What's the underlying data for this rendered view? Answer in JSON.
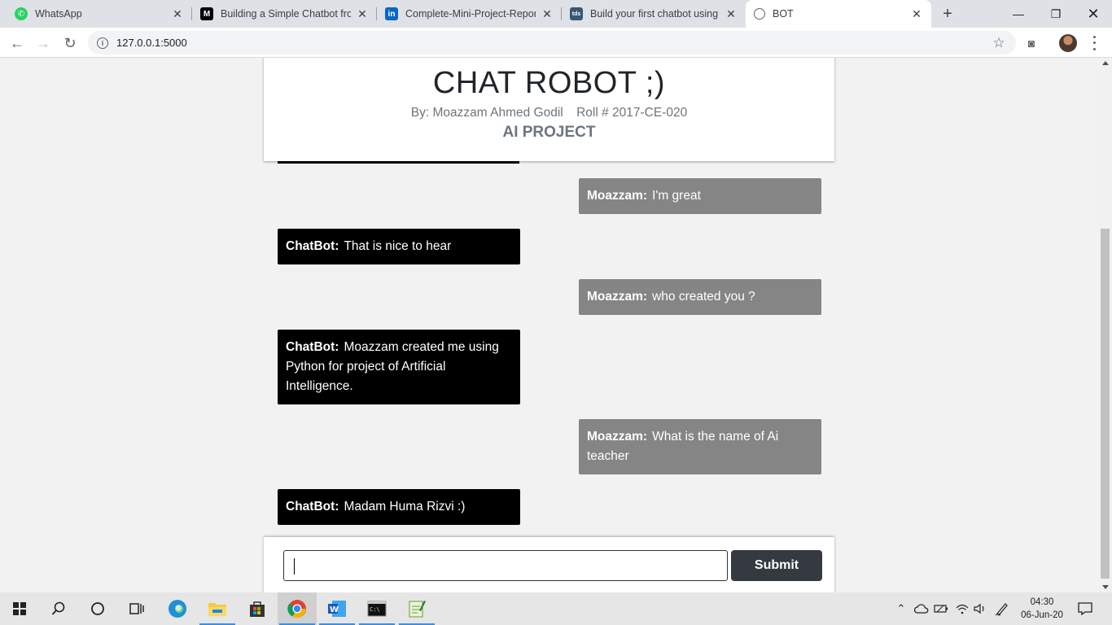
{
  "browser": {
    "tabs": [
      {
        "title": "WhatsApp",
        "icon": "whatsapp-icon",
        "color": "#25d366"
      },
      {
        "title": "Building a Simple Chatbot from",
        "icon": "medium-icon",
        "color": "#000000"
      },
      {
        "title": "Complete-Mini-Project-Report",
        "icon": "linkedin-icon",
        "color": "#0a66c2"
      },
      {
        "title": "Build your first chatbot using P",
        "icon": "tds-icon",
        "color": "#355876"
      },
      {
        "title": "BOT",
        "icon": "globe-icon",
        "color": "#5f6368"
      }
    ],
    "url": "127.0.0.1:5000"
  },
  "page": {
    "title": "CHAT ROBOT ;)",
    "author": "By: Moazzam Ahmed Godil",
    "roll": "Roll # 2017-CE-020",
    "project": "AI PROJECT"
  },
  "messages": [
    {
      "sender": "Moazzam:",
      "text": "I'm great",
      "role": "user"
    },
    {
      "sender": "ChatBot:",
      "text": "That is nice to hear",
      "role": "bot"
    },
    {
      "sender": "Moazzam:",
      "text": "who created you ?",
      "role": "user"
    },
    {
      "sender": "ChatBot:",
      "text": "Moazzam created me using Python for project of Artificial Intelligence.",
      "role": "bot"
    },
    {
      "sender": "Moazzam:",
      "text": "What is the name of Ai teacher",
      "role": "user"
    },
    {
      "sender": "ChatBot:",
      "text": "Madam Huma Rizvi :)",
      "role": "bot"
    }
  ],
  "input": {
    "value": "",
    "submit_label": "Submit"
  },
  "taskbar": {
    "time": "04:30",
    "date": "06-Jun-20",
    "apps": [
      "windows-start-icon",
      "search-icon",
      "cortana-icon",
      "task-view-icon",
      "edge-icon",
      "file-explorer-icon",
      "store-icon",
      "chrome-icon",
      "word-icon",
      "terminal-icon",
      "notepad-icon"
    ]
  },
  "colors": {
    "bot_bubble": "#000000",
    "user_bubble": "#858585",
    "submit": "#343a40"
  }
}
